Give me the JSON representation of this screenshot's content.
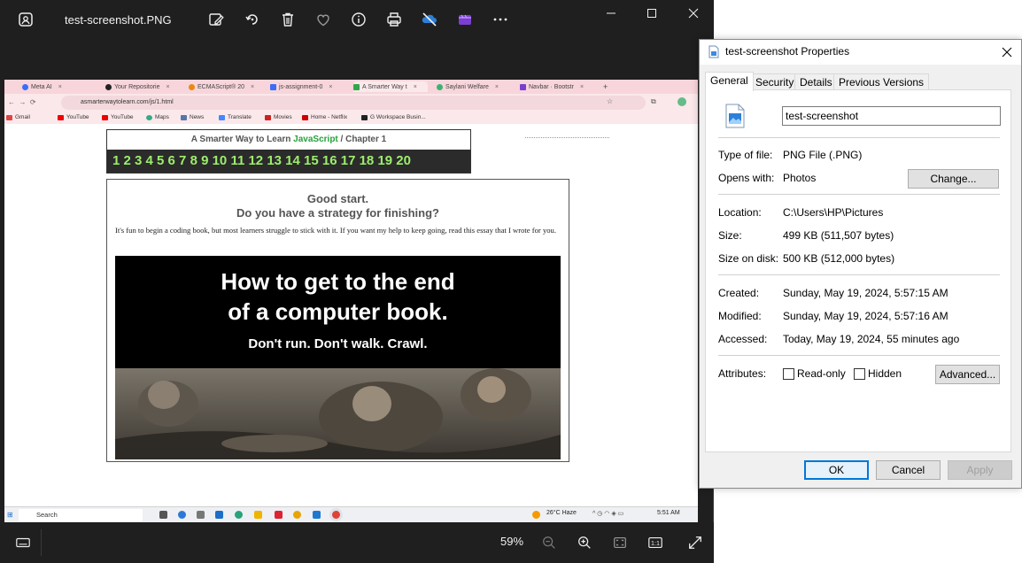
{
  "photos": {
    "title": "test-screenshot.PNG",
    "toolbar": [
      "edit-image-icon",
      "rotate-icon",
      "delete-icon",
      "favorite-icon",
      "info-icon",
      "print-icon",
      "onedrive-icon",
      "clipchamp-icon",
      "more-icon"
    ],
    "zoom": "59%"
  },
  "screenshot": {
    "tabs": [
      {
        "label": "Meta AI"
      },
      {
        "label": "Your Repositorie"
      },
      {
        "label": "ECMAScript® 20"
      },
      {
        "label": "js-assignment-0"
      },
      {
        "label": "A Smarter Way t"
      },
      {
        "label": "Saylani Welfare"
      },
      {
        "label": "Navbar · Bootstr"
      }
    ],
    "url": "asmarterwaytolearn.com/js/1.html",
    "bookmarks": [
      "Gmail",
      "YouTube",
      "YouTube",
      "Maps",
      "News",
      "Translate",
      "Movies",
      "Home - Netflix",
      "G Workspace Busin..."
    ],
    "chapter_prefix": "A Smarter Way to Learn",
    "chapter_js": "JavaScript",
    "chapter_suffix": "/ Chapter 1",
    "chapter_numbers": "1 2 3 4 5 6 7 8 9 10 11 12 13 14 15 16 17 18 19 20",
    "card_h1": "Good start.",
    "card_h2": "Do you have a strategy for finishing?",
    "card_p": "It's fun to begin a coding book, but most learners struggle to stick with it. If you want my help to keep going, read this essay that I wrote for you.",
    "hero_l1": "How to get to the end",
    "hero_l2": "of a computer book.",
    "hero_l3": "Don't run. Don't walk. Crawl.",
    "taskbar_search": "Search",
    "weather": "26°C  Haze",
    "clock": "5:51 AM"
  },
  "dialog": {
    "title": "test-screenshot Properties",
    "tabs": [
      "General",
      "Security",
      "Details",
      "Previous Versions"
    ],
    "filename": "test-screenshot",
    "rows": {
      "type_label": "Type of file:",
      "type_value": "PNG File (.PNG)",
      "opens_label": "Opens with:",
      "opens_value": "Photos",
      "change_button": "Change...",
      "location_label": "Location:",
      "location_value": "C:\\Users\\HP\\Pictures",
      "size_label": "Size:",
      "size_value": "499 KB (511,507 bytes)",
      "sizedisk_label": "Size on disk:",
      "sizedisk_value": "500 KB (512,000 bytes)",
      "created_label": "Created:",
      "created_value": "Sunday, May 19, 2024, 5:57:15 AM",
      "modified_label": "Modified:",
      "modified_value": "Sunday, May 19, 2024, 5:57:16 AM",
      "accessed_label": "Accessed:",
      "accessed_value": "Today, May 19, 2024, 55 minutes ago",
      "attributes_label": "Attributes:",
      "readonly_label": "Read-only",
      "hidden_label": "Hidden",
      "advanced_button": "Advanced..."
    },
    "ok": "OK",
    "cancel": "Cancel",
    "apply": "Apply"
  }
}
